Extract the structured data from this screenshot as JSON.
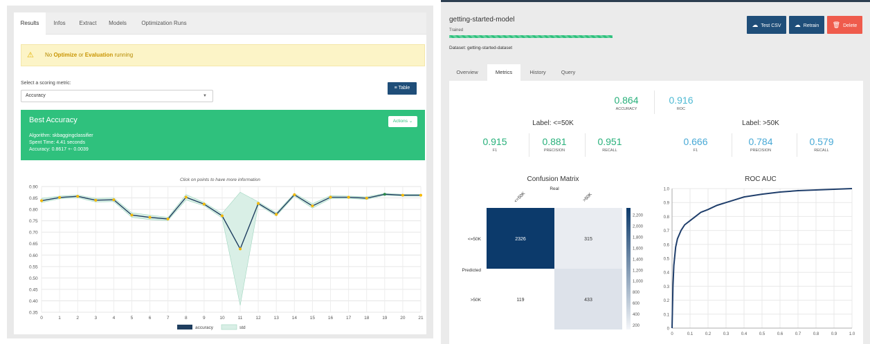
{
  "left": {
    "tabs": [
      "Results",
      "Infos",
      "Extract",
      "Models",
      "Optimization Runs"
    ],
    "active_tab": "Results",
    "warning": {
      "prefix": "No ",
      "optimize": "Optimize",
      "or": " or ",
      "evaluation": "Evaluation",
      "suffix": " running"
    },
    "scoring_label": "Select a scoring metric:",
    "scoring_value": "Accuracy",
    "table_button": "Table",
    "best": {
      "title": "Best Accuracy",
      "algorithm": "Algorithm: skbaggingclassifier",
      "spent": "Spent Time: 4.41 seconds",
      "accuracy": "Accuracy: 0.8617 +- 0.0039",
      "actions": "Actions"
    },
    "chart_caption": "Click on points to have more information"
  },
  "right": {
    "model_name": "getting-started-model",
    "status": "Trained",
    "dataset": "Dataset: getting-started-dataset",
    "buttons": {
      "test_csv": "Test CSV",
      "retrain": "Retrain",
      "delete": "Delete"
    },
    "tabs": [
      "Overview",
      "Metrics",
      "History",
      "Query"
    ],
    "active_tab": "Metrics",
    "accuracy": {
      "value": "0.864",
      "label": "ACCURACY"
    },
    "roc": {
      "value": "0.916",
      "label": "ROC"
    },
    "label_le": {
      "title": "Label: <=50K",
      "f1": "0.915",
      "precision": "0.881",
      "recall": "0.951"
    },
    "label_gt": {
      "title": "Label: >50K",
      "f1": "0.666",
      "precision": "0.784",
      "recall": "0.579"
    },
    "metric_names": {
      "f1": "F1",
      "precision": "PRECISION",
      "recall": "RECALL"
    },
    "confusion_title": "Confusion Matrix",
    "roc_title": "ROC AUC"
  },
  "chart_data": [
    {
      "type": "line",
      "x": [
        0,
        1,
        2,
        3,
        4,
        5,
        6,
        7,
        8,
        9,
        10,
        11,
        12,
        13,
        14,
        15,
        16,
        17,
        18,
        19,
        20,
        21
      ],
      "series": [
        {
          "name": "accuracy",
          "values": [
            0.838,
            0.852,
            0.857,
            0.84,
            0.842,
            0.775,
            0.765,
            0.758,
            0.853,
            0.823,
            0.772,
            0.627,
            0.826,
            0.778,
            0.864,
            0.815,
            0.853,
            0.853,
            0.849,
            0.866,
            0.862,
            0.862
          ]
        },
        {
          "name": "std",
          "upper": [
            0.848,
            0.858,
            0.863,
            0.848,
            0.85,
            0.785,
            0.775,
            0.765,
            0.865,
            0.83,
            0.782,
            0.875,
            0.833,
            0.785,
            0.87,
            0.825,
            0.86,
            0.858,
            0.855,
            0.87,
            0.866,
            0.866
          ],
          "lower": [
            0.83,
            0.846,
            0.851,
            0.832,
            0.834,
            0.765,
            0.755,
            0.751,
            0.841,
            0.816,
            0.762,
            0.38,
            0.819,
            0.771,
            0.858,
            0.805,
            0.846,
            0.848,
            0.843,
            0.862,
            0.858,
            0.858
          ]
        }
      ],
      "ylim": [
        0.35,
        0.9
      ],
      "yticks": [
        "0.90",
        "0.85",
        "0.80",
        "0.75",
        "0.70",
        "0.65",
        "0.60",
        "0.55",
        "0.50",
        "0.45",
        "0.40",
        "0.35"
      ],
      "legend": [
        "accuracy",
        "std"
      ],
      "grid": true,
      "colors": {
        "line": "#1f3e5f",
        "band": "#d9efe6",
        "point": "#f5b800",
        "point_green": "#2a8a4a"
      }
    },
    {
      "type": "heatmap",
      "title": "Confusion Matrix",
      "columns": [
        "<=50K",
        ">50K"
      ],
      "rows": [
        "<=50K",
        ">50K"
      ],
      "column_axis_label": "Real",
      "row_axis_label": "Predicted",
      "values": [
        [
          2326,
          315
        ],
        [
          119,
          433
        ]
      ],
      "colorbar_ticks": [
        "2,200",
        "2,000",
        "1,800",
        "1,600",
        "1,400",
        "1,200",
        "1,000",
        "800",
        "600",
        "400",
        "200"
      ],
      "colorbar_range": [
        119,
        2326
      ],
      "colors": {
        "high": "#0c3a6b",
        "low": "#ffffff"
      }
    },
    {
      "type": "line",
      "title": "ROC AUC",
      "x": [
        0,
        0.005,
        0.01,
        0.02,
        0.03,
        0.05,
        0.07,
        0.1,
        0.13,
        0.16,
        0.2,
        0.25,
        0.3,
        0.35,
        0.4,
        0.5,
        0.6,
        0.7,
        0.8,
        0.9,
        1.0
      ],
      "y": [
        0,
        0.3,
        0.45,
        0.58,
        0.64,
        0.7,
        0.74,
        0.77,
        0.8,
        0.83,
        0.85,
        0.88,
        0.9,
        0.92,
        0.94,
        0.96,
        0.975,
        0.985,
        0.99,
        0.995,
        1.0
      ],
      "xlim": [
        0,
        1
      ],
      "ylim": [
        0,
        1
      ],
      "xticks": [
        "0",
        "0.1",
        "0.2",
        "0.3",
        "0.4",
        "0.5",
        "0.6",
        "0.7",
        "0.8",
        "0.9",
        "1.0"
      ],
      "yticks": [
        "0",
        "0.1",
        "0.2",
        "0.3",
        "0.4",
        "0.5",
        "0.6",
        "0.7",
        "0.8",
        "0.9",
        "1.0"
      ],
      "grid": true,
      "colors": {
        "line": "#1f3e6b"
      }
    }
  ],
  "colors": {
    "accent_blue": "#1f4e79",
    "green": "#2fc17d",
    "delete_red": "#ef5b4c",
    "metric_green": "#27b07a",
    "metric_teal": "#4cb9d3",
    "metric_blue": "#48a9d6"
  }
}
